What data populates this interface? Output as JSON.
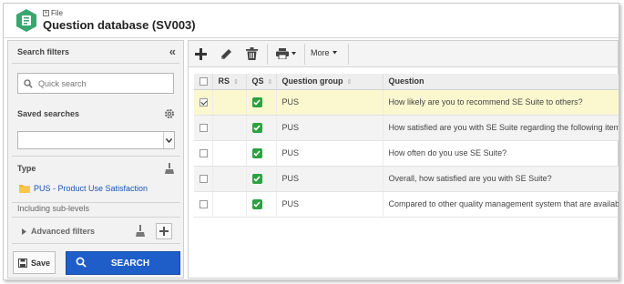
{
  "header": {
    "file_label": "File",
    "title": "Question database (SV003)"
  },
  "filters": {
    "title": "Search filters",
    "quick_search_placeholder": "Quick search",
    "saved_searches_label": "Saved searches",
    "saved_search_value": "",
    "type_label": "Type",
    "type_value": "PUS - Product Use Satisfaction",
    "sublevels_label": "Including sub-levels",
    "advanced_label": "Advanced filters",
    "save_label": "Save",
    "search_label": "SEARCH"
  },
  "toolbar": {
    "add_icon": "plus-icon",
    "edit_icon": "pencil-icon",
    "delete_icon": "trash-icon",
    "print_icon": "printer-icon",
    "more_label": "More"
  },
  "grid": {
    "columns": [
      "RS",
      "QS",
      "Question group",
      "Question"
    ],
    "rows": [
      {
        "selected": true,
        "qs": true,
        "group": "PUS",
        "question": "How likely are you to recommend SE Suite to others?"
      },
      {
        "selected": false,
        "qs": true,
        "group": "PUS",
        "question": "How satisfied are you with SE Suite regarding the following items?"
      },
      {
        "selected": false,
        "qs": true,
        "group": "PUS",
        "question": "How often do you use SE Suite?"
      },
      {
        "selected": false,
        "qs": true,
        "group": "PUS",
        "question": "Overall, how satisfied are you with SE Suite?"
      },
      {
        "selected": false,
        "qs": true,
        "group": "PUS",
        "question": "Compared to other quality management system that are available,"
      }
    ]
  },
  "colors": {
    "accent": "#1f5ec9",
    "selected_row": "#fbf8cf",
    "check_green": "#2ea043",
    "link": "#1a55b8"
  }
}
